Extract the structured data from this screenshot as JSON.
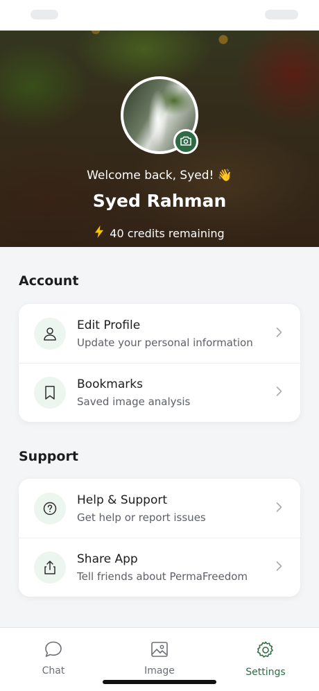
{
  "profile": {
    "welcome": "Welcome back, Syed! 👋",
    "name": "Syed Rahman",
    "credits_text": "40 credits remaining"
  },
  "sections": {
    "account": {
      "title": "Account",
      "items": [
        {
          "title": "Edit Profile",
          "subtitle": "Update your personal information",
          "icon": "user-icon"
        },
        {
          "title": "Bookmarks",
          "subtitle": "Saved image analysis",
          "icon": "bookmark-icon"
        }
      ]
    },
    "support": {
      "title": "Support",
      "items": [
        {
          "title": "Help & Support",
          "subtitle": "Get help or report issues",
          "icon": "help-icon"
        },
        {
          "title": "Share App",
          "subtitle": "Tell friends about PermaFreedom",
          "icon": "share-icon"
        }
      ]
    }
  },
  "tabbar": {
    "tabs": [
      {
        "label": "Chat",
        "icon": "chat-icon"
      },
      {
        "label": "Image",
        "icon": "image-icon"
      },
      {
        "label": "Settings",
        "icon": "gear-icon"
      }
    ],
    "active": "Settings"
  },
  "colors": {
    "accent": "#2e6b45",
    "icon_bg": "#edf6ee",
    "lightning": "#f5c400"
  }
}
